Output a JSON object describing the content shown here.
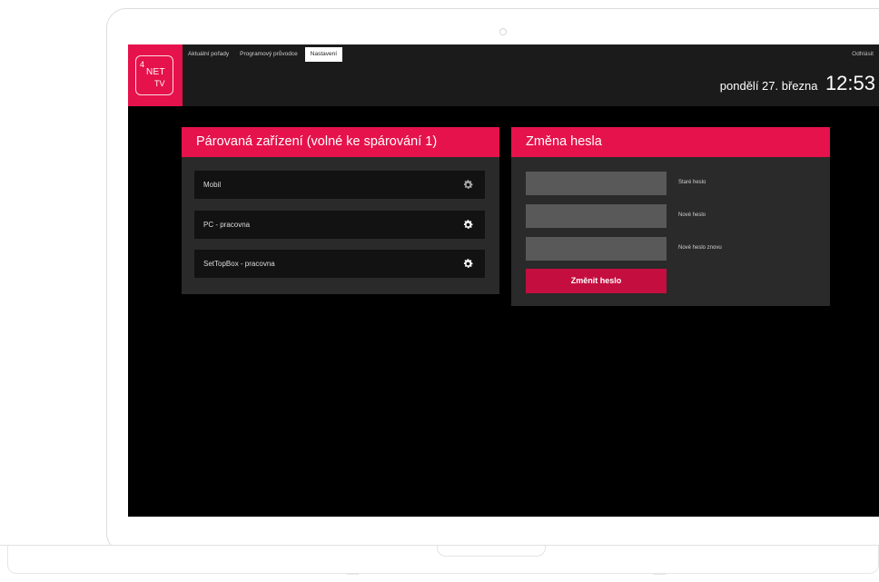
{
  "brand": {
    "logo_four": "4",
    "logo_net": "NET",
    "logo_tv": "TV",
    "accent_color": "#e6124b"
  },
  "nav": {
    "items": [
      {
        "label": "Aktuální pořady"
      },
      {
        "label": "Programový průvodce"
      },
      {
        "label": "Nastavení"
      }
    ],
    "active": "Nastavení",
    "logout_label": "Odhlásit"
  },
  "header": {
    "date": "pondělí 27. března",
    "time": "12:53"
  },
  "devices_panel": {
    "title": "Párovaná zařízení (volné ke spárování 1)",
    "devices": [
      {
        "name": "Mobil",
        "icon": "gear-icon"
      },
      {
        "name": "PC - pracovna",
        "icon": "gear-icon"
      },
      {
        "name": "SetTopBox - pracovna",
        "icon": "gear-icon"
      }
    ]
  },
  "password_panel": {
    "title": "Změna hesla",
    "fields": [
      {
        "label": "Staré heslo",
        "value": ""
      },
      {
        "label": "Nové heslo",
        "value": ""
      },
      {
        "label": "Nové heslo znovu",
        "value": ""
      }
    ],
    "submit_label": "Změnit heslo"
  }
}
